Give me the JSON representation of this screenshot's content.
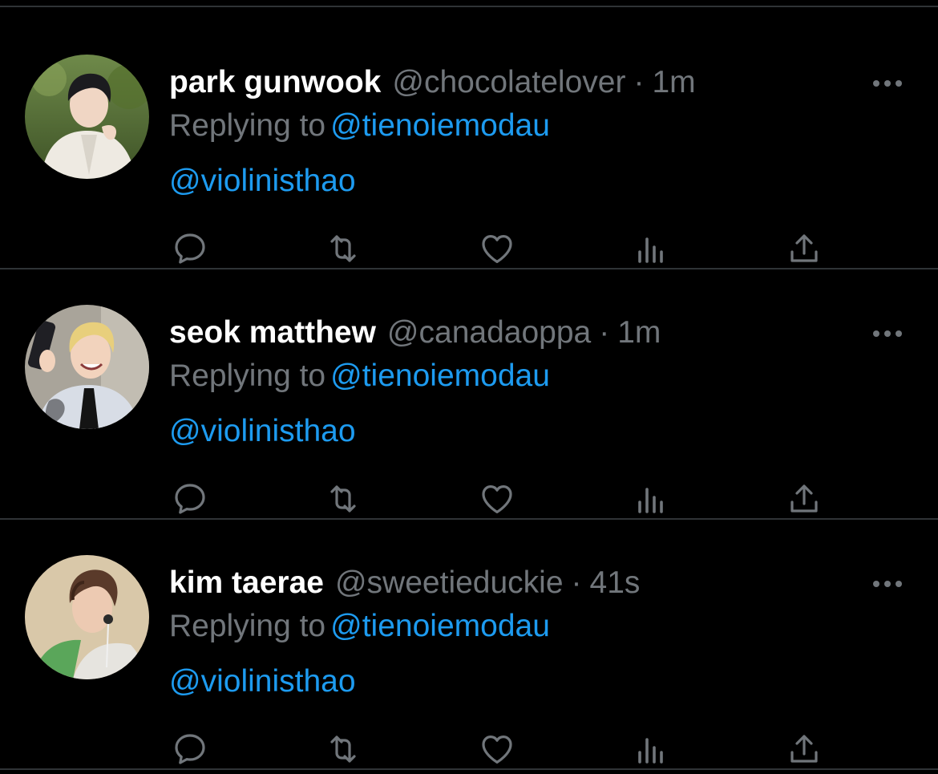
{
  "colors": {
    "background": "#000000",
    "name_text": "#ffffff",
    "secondary_text": "#71767b",
    "link": "#1d9bf0",
    "divider": "#2f3336",
    "icon": "#71767b"
  },
  "tweets": [
    {
      "display_name": "park gunwook",
      "handle": "@chocolatelover",
      "separator": "·",
      "time": "1m",
      "replying_prefix": "Replying to",
      "replying_to": "@tienoiemodau",
      "body": "@violinisthao",
      "avatar": "profile-photo-outdoor-white-outfit"
    },
    {
      "display_name": "seok matthew",
      "handle": "@canadaoppa",
      "separator": "·",
      "time": "1m",
      "replying_prefix": "Replying to",
      "replying_to": "@tienoiemodau",
      "body": "@violinisthao",
      "avatar": "profile-photo-selfie-blond-tie"
    },
    {
      "display_name": "kim taerae",
      "handle": "@sweetieduckie",
      "separator": "·",
      "time": "41s",
      "replying_prefix": "Replying to",
      "replying_to": "@tienoiemodau",
      "body": "@violinisthao",
      "avatar": "profile-photo-earphones-green-sweater"
    }
  ],
  "icons": {
    "more": "more-horizontal-icon",
    "reply": "reply-bubble-icon",
    "retweet": "retweet-icon",
    "like": "heart-icon",
    "views": "views-chart-icon",
    "share": "share-upload-icon"
  }
}
